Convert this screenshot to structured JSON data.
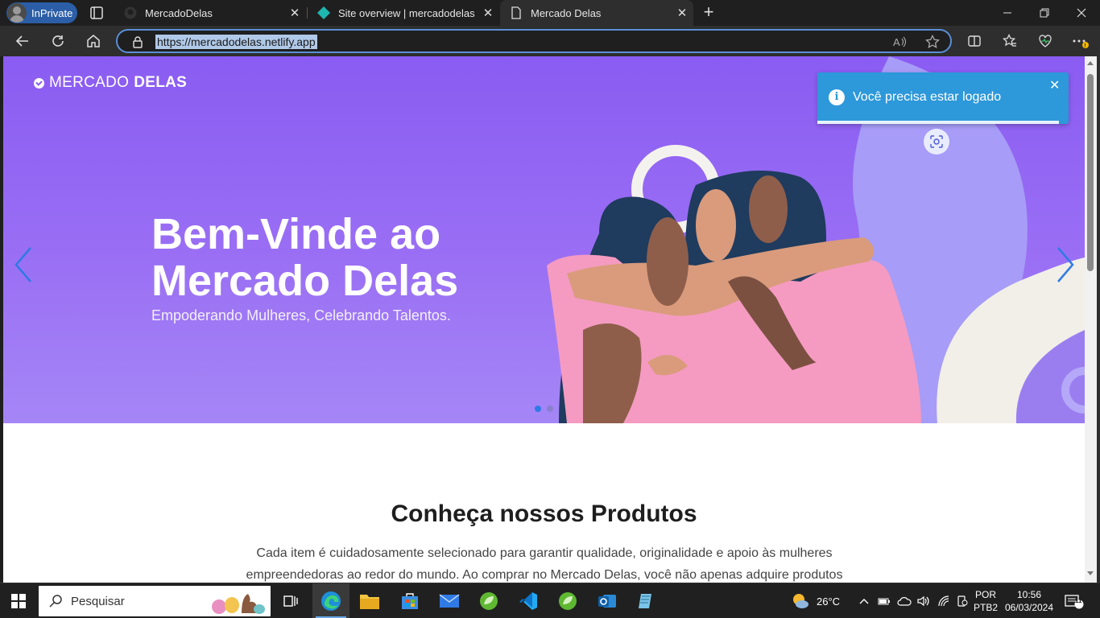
{
  "browser": {
    "inprivate_label": "InPrivate",
    "tabs": [
      {
        "title": "MercadoDelas",
        "active": false
      },
      {
        "title": "Site overview | mercadodelas | Ne",
        "active": false
      },
      {
        "title": "Mercado Delas",
        "active": true
      }
    ],
    "url": "https://mercadodelas.netlify.app"
  },
  "page": {
    "brand_light": "MERCADO",
    "brand_bold": "DELAS",
    "hero_title": "Bem-Vinde ao Mercado Delas",
    "hero_subtitle": "Empoderando Mulheres, Celebrando Talentos.",
    "toast_message": "Você precisa estar logado",
    "section_title": "Conheça nossos Produtos",
    "section_text": "Cada item é cuidadosamente selecionado para garantir qualidade, originalidade e apoio às mulheres empreendedoras ao redor do mundo. Ao comprar no Mercado Delas, você não apenas adquire produtos"
  },
  "taskbar": {
    "search_placeholder": "Pesquisar",
    "temperature": "26°C",
    "lang_line1": "POR",
    "lang_line2": "PTB2",
    "time": "10:56",
    "date": "06/03/2024",
    "notification_count": "11"
  },
  "colors": {
    "hero_purple": "#8a5cf2",
    "toast_blue": "#2d98da",
    "carousel_arrow": "#2f7ae5"
  }
}
